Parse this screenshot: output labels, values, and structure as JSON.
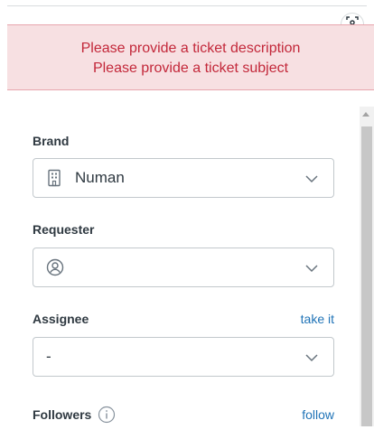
{
  "alert": {
    "lines": [
      "Please provide a ticket description",
      "Please provide a ticket subject"
    ]
  },
  "brand": {
    "label": "Brand",
    "value": "Numan",
    "icon": "building-icon"
  },
  "requester": {
    "label": "Requester",
    "value": "",
    "icon": "user-circle-icon"
  },
  "assignee": {
    "label": "Assignee",
    "link": "take it",
    "value": "-"
  },
  "followers": {
    "label": "Followers",
    "link": "follow",
    "icon": "info-icon"
  },
  "colors": {
    "alert_bg": "#f7e0e2",
    "alert_text": "#c3283a",
    "link": "#1f73b7",
    "text": "#2f3941",
    "border": "#c2c8cc"
  }
}
